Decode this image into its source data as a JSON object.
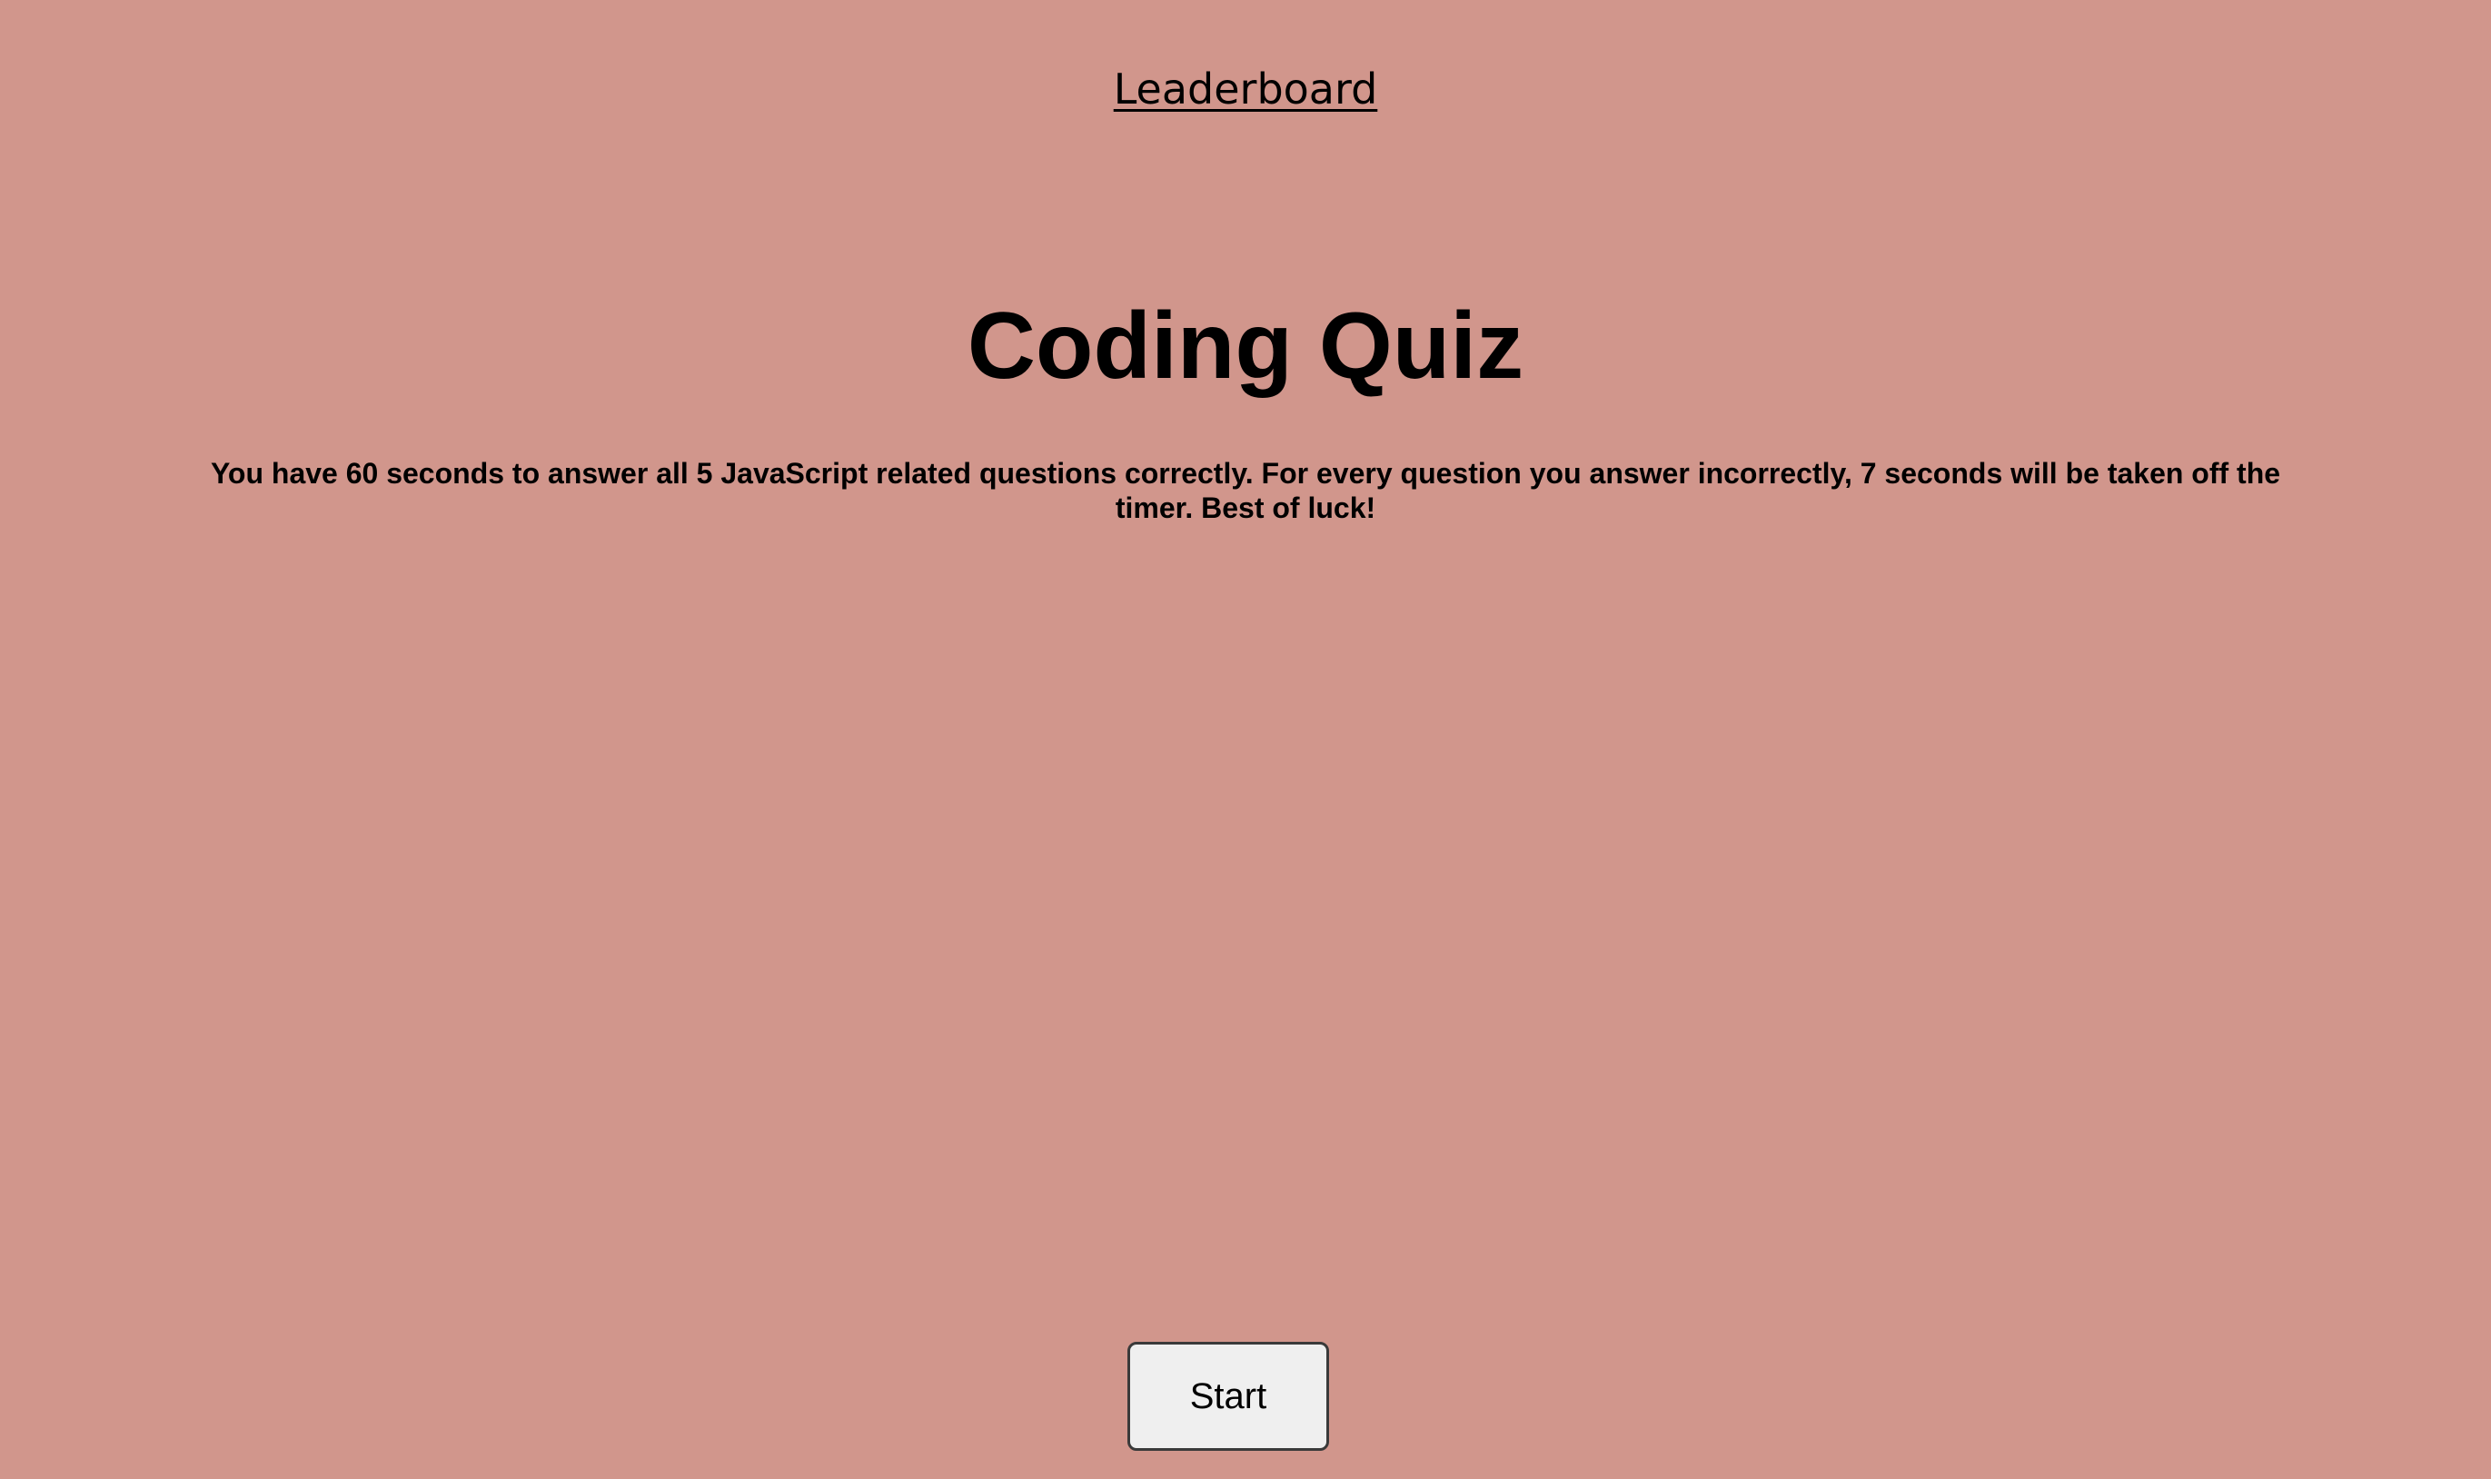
{
  "header": {
    "leaderboard_link": "Leaderboard"
  },
  "main": {
    "title": "Coding Quiz",
    "instructions": "You have 60 seconds to answer all 5 JavaScript related questions correctly. For every question you answer incorrectly, 7 seconds will be taken off the timer. Best of luck!",
    "start_label": "Start"
  },
  "colors": {
    "background": "#d1968c",
    "text": "#000000",
    "button_background": "#efefef",
    "button_border": "#3a3a3a"
  }
}
